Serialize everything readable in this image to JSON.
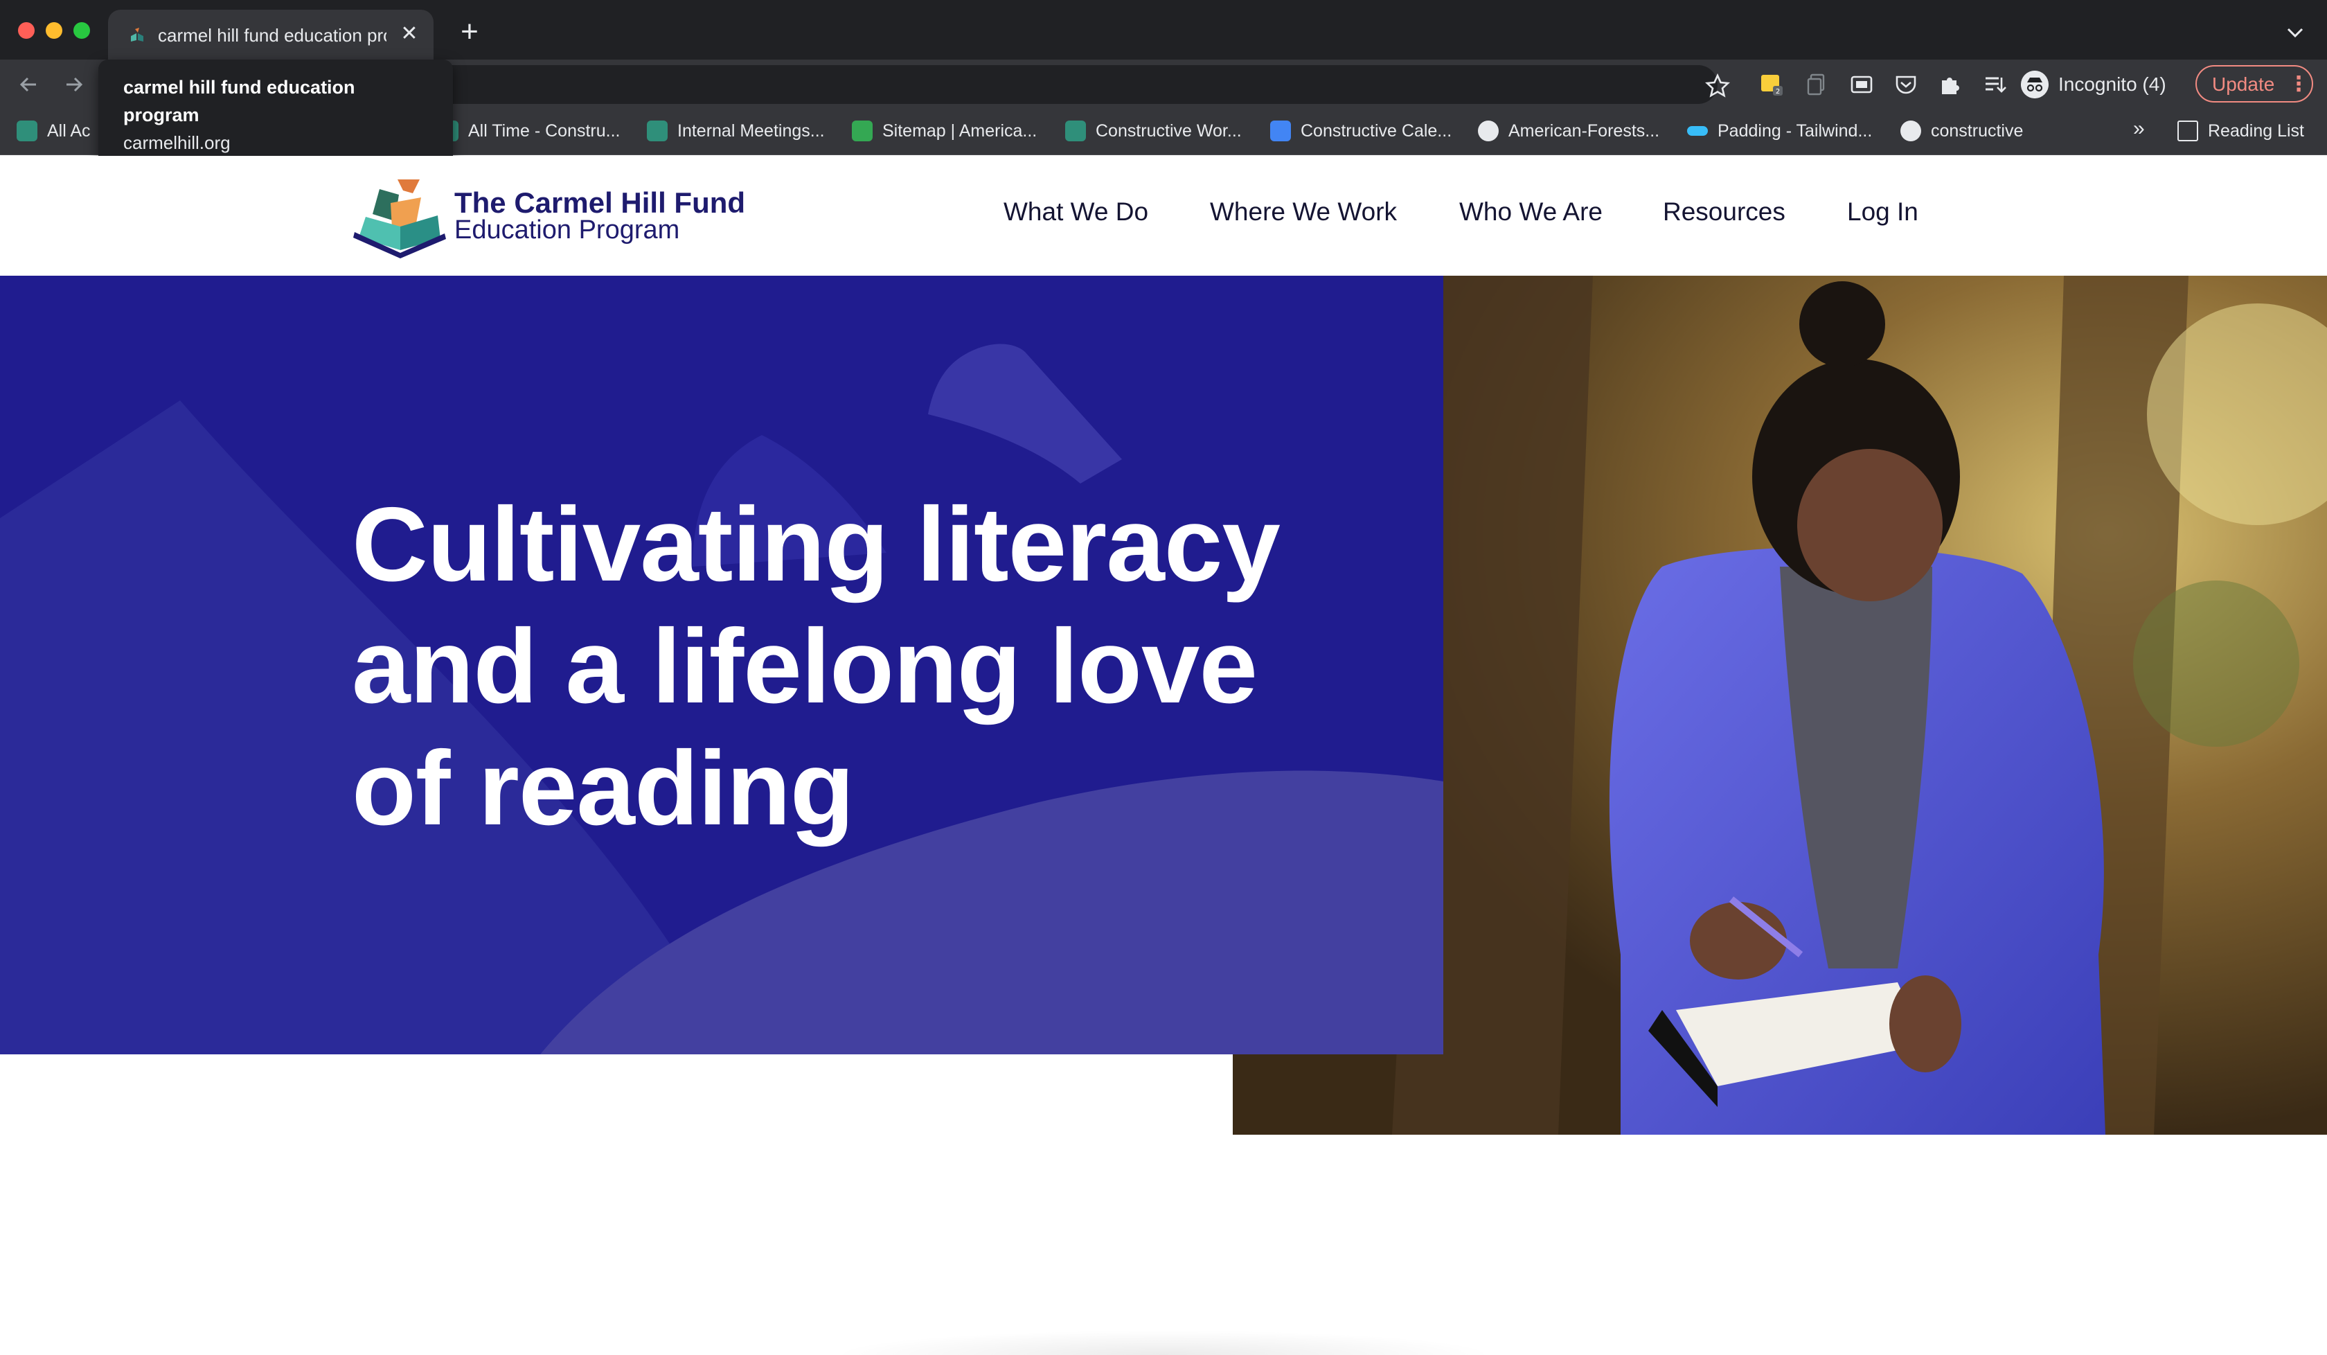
{
  "browser": {
    "tab": {
      "title": "carmel hill fund education program"
    },
    "tooltip": {
      "title": "carmel hill fund education program",
      "url": "carmelhill.org"
    },
    "profile": {
      "label": "Incognito (4)"
    },
    "update": {
      "label": "Update"
    },
    "bookmarks": [
      {
        "label": "All Ac",
        "icon": "constructive-icon"
      },
      {
        "label": "All Time - Constru...",
        "icon": "constructive-icon"
      },
      {
        "label": "Internal Meetings...",
        "icon": "constructive-icon"
      },
      {
        "label": "Sitemap | America...",
        "icon": "sheets-icon"
      },
      {
        "label": "Constructive Wor...",
        "icon": "constructive-icon"
      },
      {
        "label": "Constructive Cale...",
        "icon": "calendar-icon"
      },
      {
        "label": "American-Forests...",
        "icon": "github-icon"
      },
      {
        "label": "Padding - Tailwind...",
        "icon": "tailwind-icon"
      },
      {
        "label": "constructive",
        "icon": "github-icon"
      }
    ],
    "bookmarks_overflow": "»",
    "reading_list": "Reading List"
  },
  "site": {
    "logo": {
      "line1": "The Carmel Hill Fund",
      "line2": "Education Program"
    },
    "nav": [
      "What We Do",
      "Where We Work",
      "Who We Are",
      "Resources",
      "Log In"
    ],
    "hero": {
      "heading": "Cultivating literacy and a lifelong love of reading",
      "background": "#201c8f"
    }
  },
  "colors": {
    "chrome_dark": "#202124",
    "chrome_toolbar": "#35363a",
    "brand_navy": "#1e1b6e",
    "hero_blue": "#201c8f",
    "update_red": "#f28b82"
  }
}
